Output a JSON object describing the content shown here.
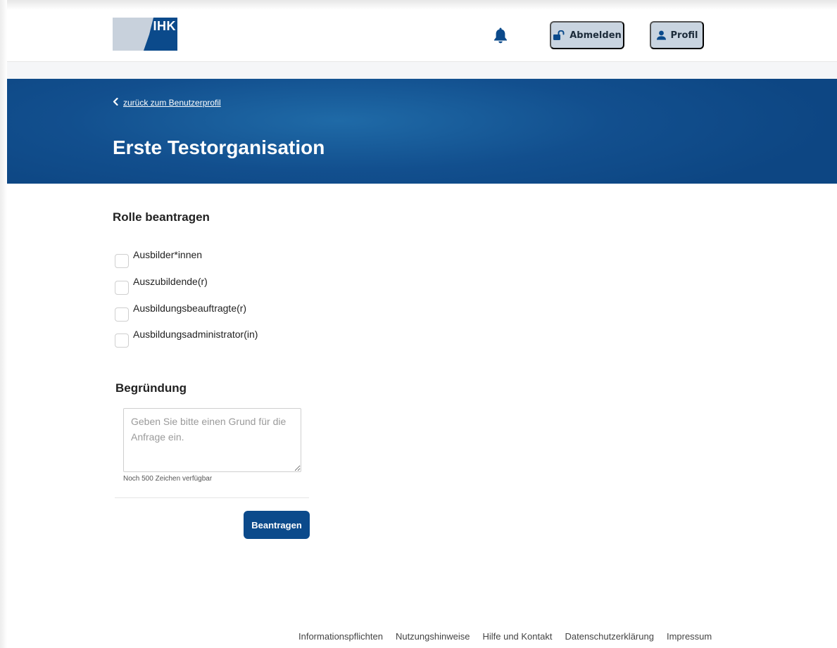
{
  "header": {
    "logo_text": "IHK",
    "logout_label": "Abmelden",
    "profile_label": "Profil"
  },
  "banner": {
    "back_link": "zurück zum Benutzerprofil",
    "title": "Erste Testorganisation"
  },
  "roles": {
    "title": "Rolle beantragen",
    "items": [
      {
        "label": "Ausbilder*innen",
        "checked": false
      },
      {
        "label": "Auszubildende(r)",
        "checked": false
      },
      {
        "label": "Ausbildungsbeauftragte(r)",
        "checked": false
      },
      {
        "label": "Ausbildungsadministrator(in)",
        "checked": false
      }
    ]
  },
  "reason": {
    "title": "Begründung",
    "placeholder": "Geben Sie bitte einen Grund für die Anfrage ein.",
    "value": "",
    "counter": "Noch 500 Zeichen verfügbar"
  },
  "submit_label": "Beantragen",
  "footer": {
    "links": [
      "Informationspflichten",
      "Nutzungshinweise",
      "Hilfe und Kontakt",
      "Datenschutzerklärung",
      "Impressum"
    ]
  },
  "colors": {
    "brand": "#0b4a8b",
    "header_button": "#c9d4e0"
  },
  "icons": {
    "bell": "bell-icon",
    "logout": "unlock-icon",
    "profile": "user-icon",
    "back": "chevron-left-icon"
  }
}
